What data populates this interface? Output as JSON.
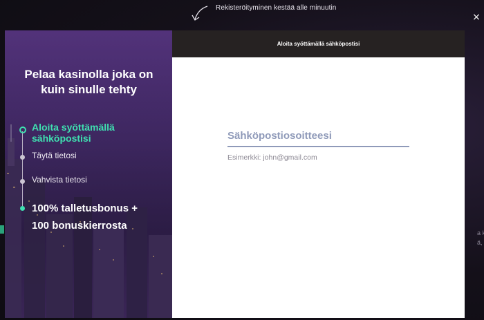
{
  "hint": {
    "text": "Rekisteröityminen kestää alle minuutin"
  },
  "close": {
    "glyph": "×"
  },
  "background": {
    "fragments": [
      "a kuu",
      "ä, Bla"
    ]
  },
  "left": {
    "title": "Pelaa kasinolla joka on kuin sinulle tehty",
    "steps": [
      {
        "label": "Aloita syöttämällä sähköpostisi",
        "state": "active"
      },
      {
        "label": "Täytä tietosi",
        "state": "pending"
      },
      {
        "label": "Vahvista tietosi",
        "state": "pending"
      },
      {
        "label": "100% talletusbonus + 100 bonuskierrosta",
        "state": "reward"
      }
    ]
  },
  "right": {
    "header": "Aloita syöttämällä sähköpostisi",
    "email": {
      "placeholder": "Sähköpostiosoitteesi",
      "value": "",
      "help": "Esimerkki: john@gmail.com"
    }
  },
  "colors": {
    "accent": "#3fe0b0",
    "field": "#8f9ab9",
    "header_bg": "#262222"
  }
}
